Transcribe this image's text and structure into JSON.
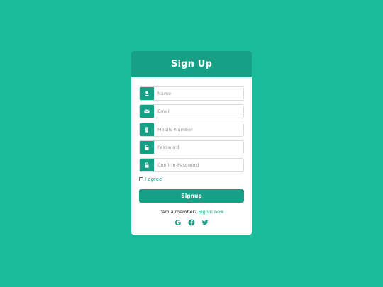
{
  "colors": {
    "background": "#1bbc9b",
    "accent": "#16a085",
    "card": "#ffffff"
  },
  "header": {
    "title": "Sign Up"
  },
  "fields": [
    {
      "icon": "user-icon",
      "placeholder": "Name",
      "value": ""
    },
    {
      "icon": "envelope-icon",
      "placeholder": "Email",
      "value": ""
    },
    {
      "icon": "mobile-icon",
      "placeholder": "Mobile-Number",
      "value": ""
    },
    {
      "icon": "lock-icon",
      "placeholder": "Password",
      "value": ""
    },
    {
      "icon": "lock-icon",
      "placeholder": "Confirm-Password",
      "value": ""
    }
  ],
  "agree": {
    "label": "I agree",
    "checked": false
  },
  "signup_button": {
    "label": "Signup"
  },
  "footer": {
    "member_text": "I'am a member? ",
    "signin_link": "SignIn now"
  },
  "socials": [
    {
      "icon": "google-icon"
    },
    {
      "icon": "facebook-icon"
    },
    {
      "icon": "twitter-icon"
    }
  ]
}
